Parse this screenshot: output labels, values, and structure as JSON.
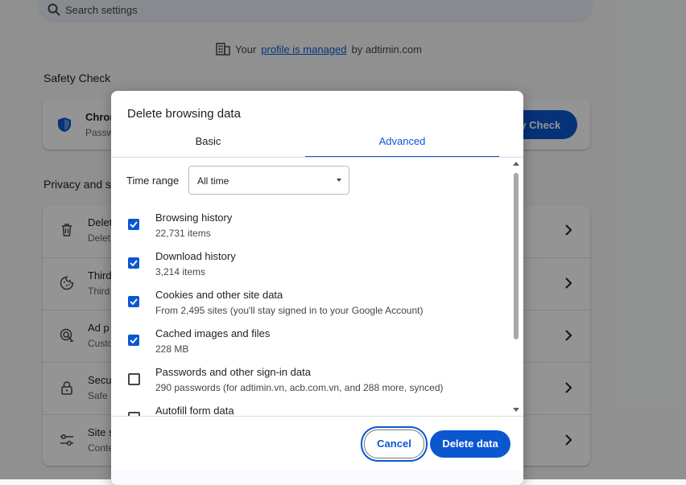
{
  "settings": {
    "search_placeholder": "Search settings",
    "managed_prefix": "Your",
    "managed_link": "profile is managed",
    "managed_suffix": "by adtimin.com",
    "safety_check_title": "Safety Check",
    "safety_row_title": "Chron",
    "safety_row_sub": "Passw",
    "safety_button": "ty Check",
    "privacy_title": "Privacy and s",
    "privacy_rows": [
      {
        "title": "Delet",
        "sub": "Delet",
        "icon": "trash-icon"
      },
      {
        "title": "Third",
        "sub": "Third",
        "icon": "cookie-icon"
      },
      {
        "title": "Ad p",
        "sub": "Custo",
        "icon": "ad-privacy-icon"
      },
      {
        "title": "Secu",
        "sub": "Safe",
        "icon": "lock-icon"
      },
      {
        "title": "Site s",
        "sub": "Conte",
        "icon": "site-settings-icon"
      }
    ]
  },
  "dialog": {
    "title": "Delete browsing data",
    "tabs": [
      "Basic",
      "Advanced"
    ],
    "active_tab": "Advanced",
    "time_range_label": "Time range",
    "time_range_value": "All time",
    "items": [
      {
        "label": "Browsing history",
        "detail": "22,731 items",
        "checked": true
      },
      {
        "label": "Download history",
        "detail": "3,214 items",
        "checked": true
      },
      {
        "label": "Cookies and other site data",
        "detail": "From 2,495 sites (you'll stay signed in to your Google Account)",
        "checked": true
      },
      {
        "label": "Cached images and files",
        "detail": "228 MB",
        "checked": true
      },
      {
        "label": "Passwords and other sign-in data",
        "detail": "290 passwords (for adtimin.vn, acb.com.vn, and 288 more, synced)",
        "checked": false
      },
      {
        "label": "Autofill form data",
        "detail": "",
        "checked": false
      }
    ],
    "cancel_label": "Cancel",
    "delete_label": "Delete data"
  },
  "colors": {
    "accent": "#0b57d0",
    "overlay": "rgba(0,0,0,0.42)"
  }
}
